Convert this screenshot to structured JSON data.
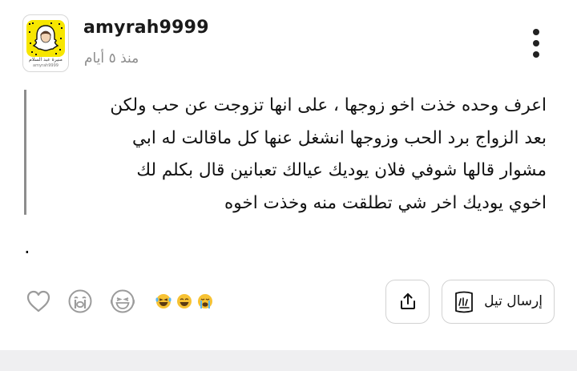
{
  "post": {
    "username": "amyrah9999",
    "time": "منذ ٥ أيام",
    "avatar": {
      "caption_line1": "منيرة عبد السلام",
      "caption_line2": "amyrah9999"
    },
    "quote_lines": [
      "اعرف وحده خذت اخو زوجها ، على انها تزوجت عن حب ولكن",
      "بعد الزواج برد الحب وزوجها انشغل عنها كل ماقالت له ابي",
      "مشوار قالها شوفي فلان يوديك عيالك تعبانين قال بكلم لك",
      "اخوي يوديك اخر شي تطلقت منه وخذت اخوه"
    ],
    "extra_text": "."
  },
  "actions": {
    "send_label": "إرسال تيل",
    "icons": [
      "heart-icon",
      "crying-face-icon",
      "laughing-face-icon",
      "reaction-emojis-icon",
      "share-icon",
      "tell-logo-icon",
      "more-options-icon"
    ]
  },
  "colors": {
    "quote_bar": "#8d8d8d",
    "snapchat_yellow": "#f7e600",
    "muted_text": "#8c8c8c",
    "emoji_yellow": "#f7c233"
  }
}
